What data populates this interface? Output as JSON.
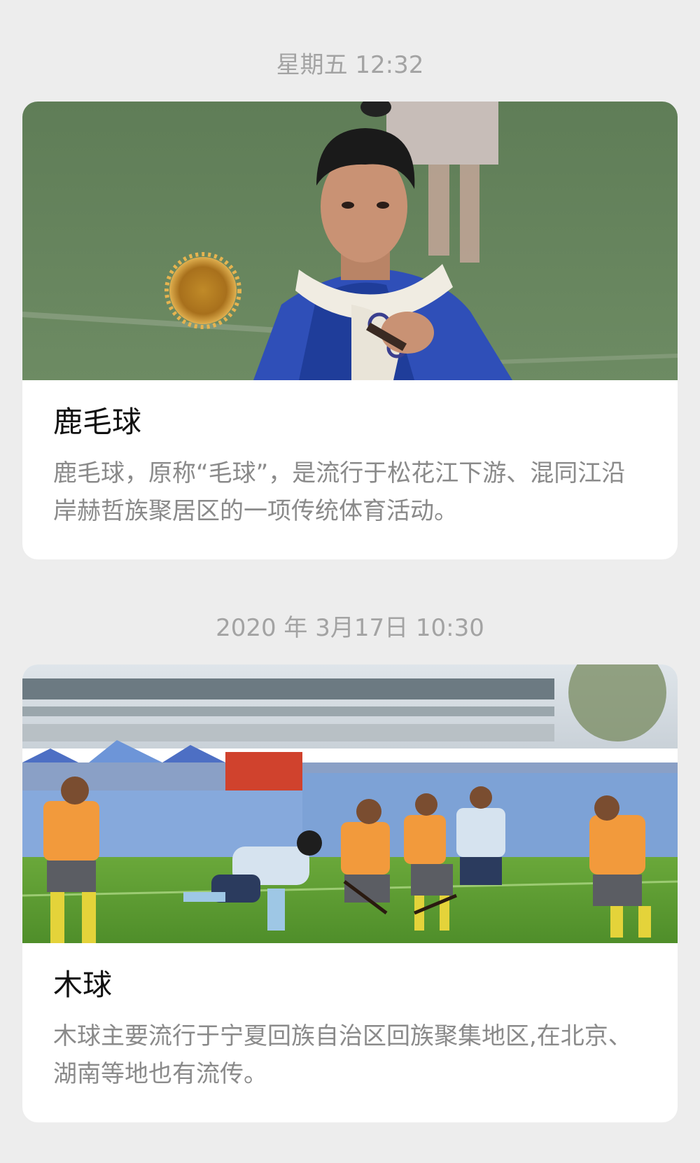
{
  "messages": [
    {
      "timestamp": "星期五 12:32",
      "title": "鹿毛球",
      "description": "鹿毛球，原称“毛球”，是流行于松花江下游、混同江沿岸赫哲族聚居区的一项传统体育活动。",
      "image_icon": "photo-player-with-fur-ball"
    },
    {
      "timestamp": "2020 年 3月17日 10:30",
      "title": "木球",
      "description": "木球主要流行于宁夏回族自治区回族聚集地区,在北京、湖南等地也有流传。",
      "image_icon": "photo-wooden-ball-match"
    }
  ]
}
